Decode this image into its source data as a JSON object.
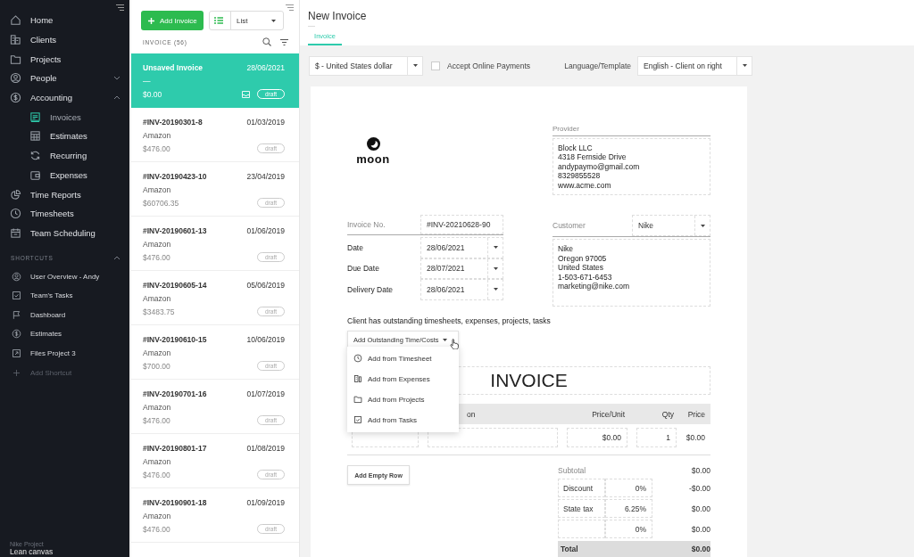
{
  "sidebar": {
    "items": [
      {
        "label": "Home",
        "selected": false
      },
      {
        "label": "Clients",
        "selected": false
      },
      {
        "label": "Projects",
        "selected": false
      },
      {
        "label": "People",
        "selected": false,
        "expanded": false
      },
      {
        "label": "Accounting",
        "selected": false,
        "expanded": true,
        "children": [
          {
            "label": "Invoices",
            "selected": true
          },
          {
            "label": "Estimates",
            "selected": false
          },
          {
            "label": "Recurring",
            "selected": false
          },
          {
            "label": "Expenses",
            "selected": false
          }
        ]
      },
      {
        "label": "Time Reports",
        "selected": false
      },
      {
        "label": "Timesheets",
        "selected": false
      },
      {
        "label": "Team Scheduling",
        "selected": false
      }
    ],
    "shortcuts": {
      "title": "SHORTCUTS",
      "expanded": true,
      "items": [
        {
          "label": "User Overview - Andy",
          "kind": "link"
        },
        {
          "label": "Team's Tasks",
          "kind": "link"
        },
        {
          "label": "Dashboard",
          "kind": "link"
        },
        {
          "label": "Estimates",
          "kind": "link"
        },
        {
          "label": "Files Project 3",
          "kind": "link"
        },
        {
          "label": "Add Shortcut",
          "kind": "add"
        }
      ]
    },
    "footer": {
      "project": "Nike Project",
      "page": "Lean canvas"
    }
  },
  "invoice_list": {
    "add_button": "Add Invoice",
    "view_select": "List",
    "heading": "INVOICE (56)",
    "items": [
      {
        "number": "Unsaved Invoice",
        "date": "28/06/2021",
        "client": "—",
        "amount": "$0.00",
        "status": "draft",
        "selected": true
      },
      {
        "number": "#INV-20190301-8",
        "date": "01/03/2019",
        "client": "Amazon",
        "amount": "$476.00",
        "status": "draft",
        "selected": false
      },
      {
        "number": "#INV-20190423-10",
        "date": "23/04/2019",
        "client": "Amazon",
        "amount": "$60706.35",
        "status": "draft",
        "selected": false
      },
      {
        "number": "#INV-20190601-13",
        "date": "01/06/2019",
        "client": "Amazon",
        "amount": "$476.00",
        "status": "draft",
        "selected": false
      },
      {
        "number": "#INV-20190605-14",
        "date": "05/06/2019",
        "client": "Amazon",
        "amount": "$3483.75",
        "status": "draft",
        "selected": false
      },
      {
        "number": "#INV-20190610-15",
        "date": "10/06/2019",
        "client": "Amazon",
        "amount": "$700.00",
        "status": "draft",
        "selected": false
      },
      {
        "number": "#INV-20190701-16",
        "date": "01/07/2019",
        "client": "Amazon",
        "amount": "$476.00",
        "status": "draft",
        "selected": false
      },
      {
        "number": "#INV-20190801-17",
        "date": "01/08/2019",
        "client": "Amazon",
        "amount": "$476.00",
        "status": "draft",
        "selected": false
      },
      {
        "number": "#INV-20190901-18",
        "date": "01/09/2019",
        "client": "Amazon",
        "amount": "$476.00",
        "status": "draft",
        "selected": false
      }
    ]
  },
  "editor": {
    "title": "New Invoice",
    "subtitle": "—",
    "tabs": [
      {
        "label": "Invoice",
        "selected": true
      }
    ],
    "currency": "$ - United States dollar",
    "online_payments": {
      "label": "Accept Online Payments",
      "checked": false
    },
    "template_label": "Language/Template",
    "template": "English - Client on right",
    "document": {
      "logo": "moon",
      "provider": {
        "label": "Provider",
        "lines": [
          "Block LLC",
          "4318 Fernside Drive",
          "andypaymo@gmail.com",
          "8329855528",
          "www.acme.com"
        ]
      },
      "fields": [
        {
          "label": "Invoice No.",
          "value": "#INV-20210628-90",
          "kind": "text"
        },
        {
          "label": "Date",
          "value": "28/06/2021",
          "kind": "date"
        },
        {
          "label": "Due Date",
          "value": "28/07/2021",
          "kind": "date"
        },
        {
          "label": "Delivery Date",
          "value": "28/06/2021",
          "kind": "date"
        }
      ],
      "customer": {
        "label": "Customer",
        "value": "Nike",
        "lines": [
          "Nike",
          "Oregon 97005",
          "United States",
          "1-503-671-6453",
          "marketing@nike.com"
        ]
      },
      "notice": "Client has outstanding timesheets, expenses, projects, tasks",
      "outstanding_button": "Add Outstanding Time/Costs",
      "outstanding_menu": [
        "Add from Timesheet",
        "Add from Expenses",
        "Add from Projects",
        "Add from Tasks"
      ],
      "heading": "INVOICE",
      "table": {
        "columns": [
          "on",
          "Price/Unit",
          "Qty",
          "Price"
        ],
        "rows": [
          {
            "price_unit": "$0.00",
            "qty": "1",
            "price": "$0.00"
          }
        ]
      },
      "add_row_button": "Add Empty Row",
      "totals": [
        {
          "kind": "subtotal",
          "label": "Subtotal",
          "amount": "$0.00"
        },
        {
          "kind": "adjustment",
          "label": "Discount",
          "rate": "0%",
          "amount": "-$0.00"
        },
        {
          "kind": "adjustment",
          "label": "State tax",
          "rate": "6.25%",
          "amount": "$0.00"
        },
        {
          "kind": "adjustment",
          "rate": "0%",
          "amount": "$0.00"
        },
        {
          "kind": "total",
          "label": "Total",
          "amount": "$0.00"
        }
      ]
    }
  }
}
